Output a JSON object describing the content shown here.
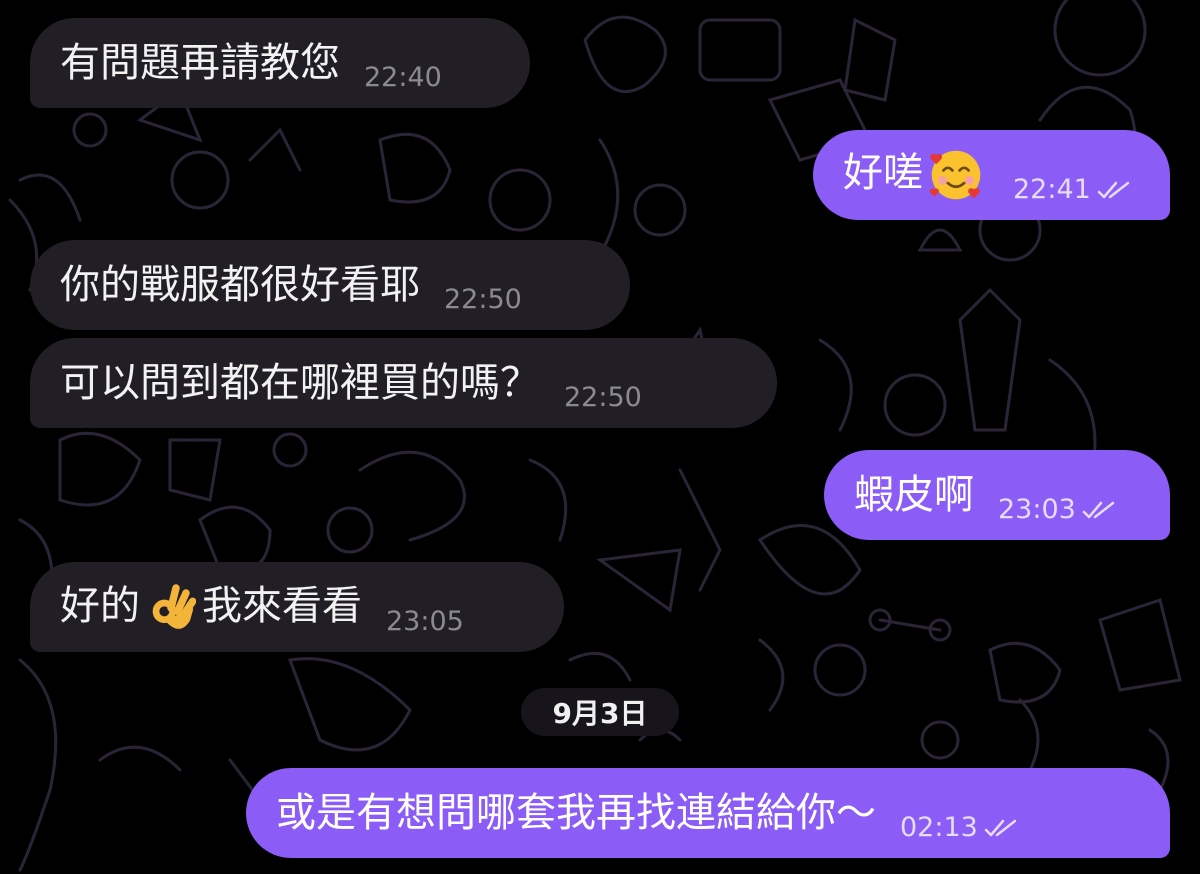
{
  "messages": [
    {
      "text": "有問題再請教您",
      "time": "22:40"
    },
    {
      "text": "好嗟",
      "emoji": "smiling-face-with-hearts",
      "time": "22:41"
    },
    {
      "text": "你的戰服都很好看耶",
      "time": "22:50"
    },
    {
      "text": "可以問到都在哪裡買的嗎？",
      "time": "22:50"
    },
    {
      "text": "蝦皮啊",
      "time": "23:03"
    },
    {
      "text_before": "好的",
      "emoji": "ok-hand",
      "text_after": "我來看看",
      "time": "23:05"
    },
    {
      "text": "或是有想問哪套我再找連結給你～",
      "time": "02:13"
    }
  ],
  "date_separator": "9月3日",
  "colors": {
    "background": "#000000",
    "incoming_bubble": "#211f25",
    "outgoing_bubble": "#8b5cf6",
    "incoming_time": "#8c8a91",
    "outgoing_time": "#e6dcfd"
  }
}
